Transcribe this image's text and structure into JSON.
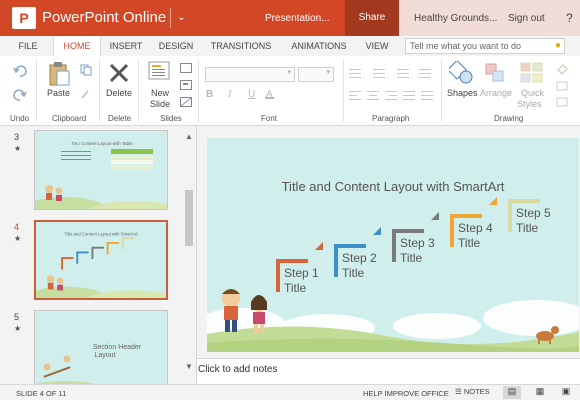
{
  "titlebar": {
    "app_name": "PowerPoint Online",
    "logo_letter": "P",
    "doc_short": "Presentation...",
    "share": "Share",
    "doc_name": "Healthy Grounds...",
    "signout": "Sign out",
    "help": "?"
  },
  "tabs": [
    "FILE",
    "HOME",
    "INSERT",
    "DESIGN",
    "TRANSITIONS",
    "ANIMATIONS",
    "VIEW"
  ],
  "active_tab": "HOME",
  "tellme_placeholder": "Tell me what you want to do",
  "ribbon": {
    "groups": {
      "undo": "Undo",
      "clipboard": "Clipboard",
      "delete": "Delete",
      "slides": "Slides",
      "font": "Font",
      "paragraph": "Paragraph",
      "drawing": "Drawing"
    },
    "buttons": {
      "paste": "Paste",
      "delete": "Delete",
      "new_slide_1": "New",
      "new_slide_2": "Slide",
      "shapes": "Shapes",
      "arrange": "Arrange",
      "quick_styles_1": "Quick",
      "quick_styles_2": "Styles"
    }
  },
  "thumbnails": [
    {
      "number": "3",
      "title": "Two Content Layout with Table"
    },
    {
      "number": "4",
      "title": "Title and Content Layout with SmartArt"
    },
    {
      "number": "5",
      "title_line1": "Section Header",
      "title_line2": "Layout"
    }
  ],
  "slide": {
    "title": "Title and Content Layout with SmartArt",
    "steps": [
      {
        "line1": "Step 1",
        "line2": "Title",
        "color": "#d9643a"
      },
      {
        "line1": "Step 2",
        "line2": "Title",
        "color": "#3e8fc4"
      },
      {
        "line1": "Step 3",
        "line2": "Title",
        "color": "#7a7a7a"
      },
      {
        "line1": "Step 4",
        "line2": "Title",
        "color": "#f0a535"
      },
      {
        "line1": "Step 5",
        "line2": "Title",
        "color": "#d8d9a0"
      }
    ]
  },
  "notes_placeholder": "Click to add notes",
  "statusbar": {
    "slide_count": "SLIDE 4 OF 11",
    "help_improve": "HELP IMPROVE OFFICE",
    "notes": "NOTES"
  },
  "colors": {
    "brand": "#d24726",
    "slide_bg": "#cfeeec"
  }
}
